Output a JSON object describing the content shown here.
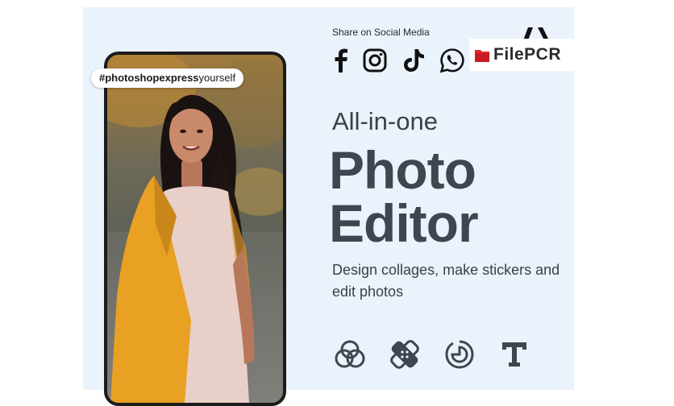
{
  "hashtag": {
    "bold": "#photoshopexpress",
    "rest": "yourself"
  },
  "share": {
    "label": "Share on Social Media",
    "icons": [
      "facebook-icon",
      "instagram-icon",
      "tiktok-icon",
      "whatsapp-icon"
    ]
  },
  "headline": "All-in-one",
  "title_line1": "Photo",
  "title_line2": "Editor",
  "description": "Design collages, make stickers and edit photos",
  "features": [
    "collage-icon",
    "sticker-icon",
    "edit-photo-icon",
    "text-icon"
  ],
  "watermark": {
    "text": "FilePCR"
  },
  "colors": {
    "background": "#eaf2fb",
    "title": "#3e4750",
    "text": "#3b4046",
    "jacket": "#e8a123",
    "watermark_red": "#e3262a"
  }
}
